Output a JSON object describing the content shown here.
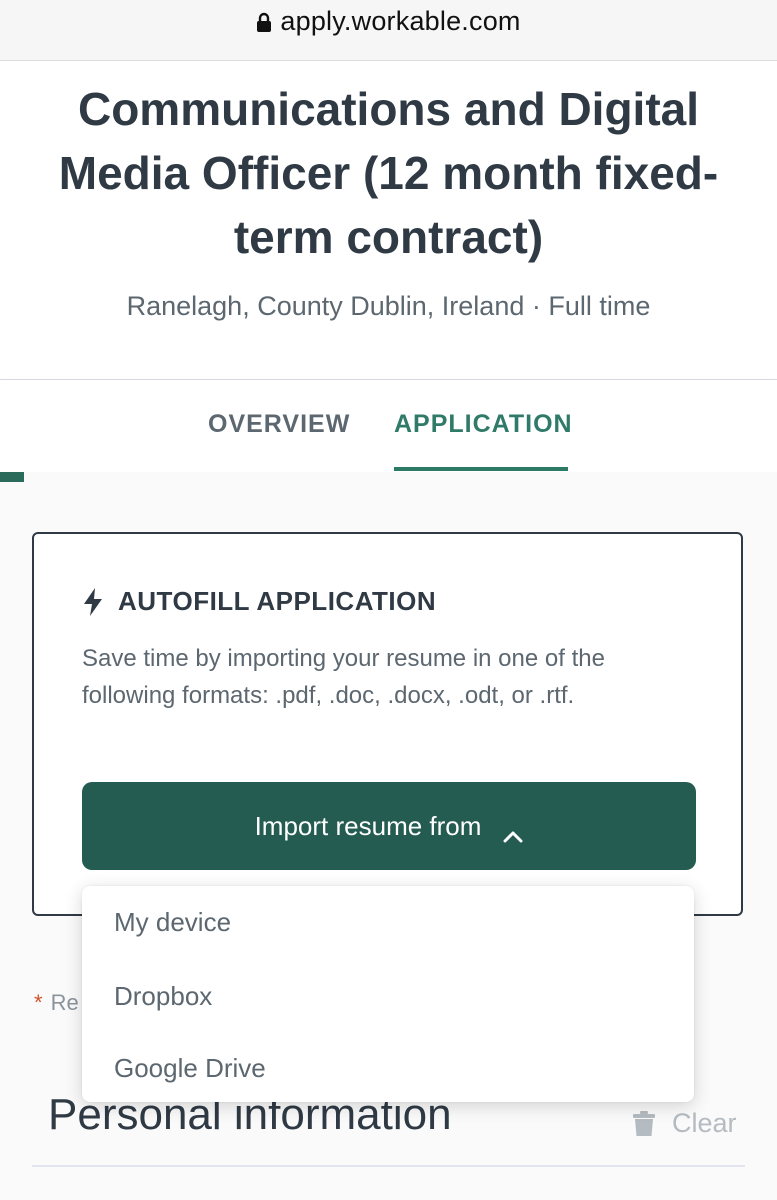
{
  "browser": {
    "url": "apply.workable.com"
  },
  "job": {
    "title": "Communications and Digital Media Officer (12 month fixed-term contract)",
    "meta": "Ranelagh, County Dublin, Ireland · Full time"
  },
  "tabs": [
    {
      "label": "OVERVIEW",
      "active": false
    },
    {
      "label": "APPLICATION",
      "active": true
    }
  ],
  "autofill": {
    "title": "AUTOFILL APPLICATION",
    "description": "Save time by importing your resume in one of the following formats: .pdf, .doc, .docx, .odt, or .rtf.",
    "button_label": "Import resume from",
    "menu_items": [
      "My device",
      "Dropbox",
      "Google Drive"
    ]
  },
  "form": {
    "required_star": "*",
    "required_partial": "Re",
    "section_title": "Personal information",
    "clear_label": "Clear"
  },
  "colors": {
    "accent": "#2a7a66",
    "button": "#245c52",
    "required_star": "#d2532b"
  },
  "icons": {
    "lock": "lock-icon",
    "bolt": "bolt-icon",
    "chevron": "chevron-up-icon",
    "trash": "trash-icon"
  }
}
